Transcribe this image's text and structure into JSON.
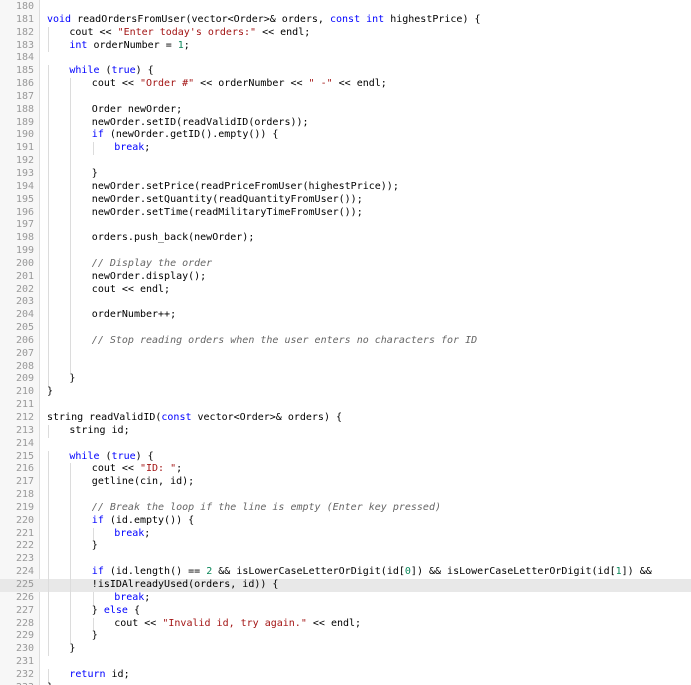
{
  "editor": {
    "active_line": 225,
    "colors": {
      "keyword": "#0000ff",
      "string": "#a31515",
      "comment": "#666666",
      "number": "#098658",
      "gutter_text": "#999999",
      "active_line_bg": "#e8e8e8"
    },
    "lines": [
      {
        "num": "180",
        "indent": 0,
        "tokens": []
      },
      {
        "num": "181",
        "indent": 0,
        "tokens": [
          [
            "kw",
            "void"
          ],
          [
            "t",
            " readOrdersFromUser(vector<Order>& orders, "
          ],
          [
            "kw",
            "const"
          ],
          [
            "t",
            " "
          ],
          [
            "kw",
            "int"
          ],
          [
            "t",
            " highestPrice) {"
          ]
        ]
      },
      {
        "num": "182",
        "indent": 1,
        "tokens": [
          [
            "t",
            "cout << "
          ],
          [
            "str",
            "\"Enter today's orders:\""
          ],
          [
            "t",
            " << endl;"
          ]
        ]
      },
      {
        "num": "183",
        "indent": 1,
        "tokens": [
          [
            "kw",
            "int"
          ],
          [
            "t",
            " orderNumber = "
          ],
          [
            "num",
            "1"
          ],
          [
            "t",
            ";"
          ]
        ]
      },
      {
        "num": "184",
        "indent": 0,
        "tokens": []
      },
      {
        "num": "185",
        "indent": 1,
        "tokens": [
          [
            "kw",
            "while"
          ],
          [
            "t",
            " ("
          ],
          [
            "kw",
            "true"
          ],
          [
            "t",
            ") {"
          ]
        ]
      },
      {
        "num": "186",
        "indent": 2,
        "tokens": [
          [
            "t",
            "cout << "
          ],
          [
            "str",
            "\"Order #\""
          ],
          [
            "t",
            " << orderNumber << "
          ],
          [
            "str",
            "\" -\""
          ],
          [
            "t",
            " << endl;"
          ]
        ]
      },
      {
        "num": "187",
        "indent": 0,
        "guides": 2,
        "tokens": []
      },
      {
        "num": "188",
        "indent": 2,
        "tokens": [
          [
            "t",
            "Order newOrder;"
          ]
        ]
      },
      {
        "num": "189",
        "indent": 2,
        "tokens": [
          [
            "t",
            "newOrder.setID(readValidID(orders));"
          ]
        ]
      },
      {
        "num": "190",
        "indent": 2,
        "tokens": [
          [
            "kw",
            "if"
          ],
          [
            "t",
            " (newOrder.getID().empty()) {"
          ]
        ]
      },
      {
        "num": "191",
        "indent": 3,
        "tokens": [
          [
            "kw",
            "break"
          ],
          [
            "t",
            ";"
          ]
        ]
      },
      {
        "num": "192",
        "indent": 0,
        "guides": 2,
        "tokens": []
      },
      {
        "num": "193",
        "indent": 2,
        "tokens": [
          [
            "t",
            "}"
          ]
        ]
      },
      {
        "num": "194",
        "indent": 2,
        "tokens": [
          [
            "t",
            "newOrder.setPrice(readPriceFromUser(highestPrice));"
          ]
        ]
      },
      {
        "num": "195",
        "indent": 2,
        "tokens": [
          [
            "t",
            "newOrder.setQuantity(readQuantityFromUser());"
          ]
        ]
      },
      {
        "num": "196",
        "indent": 2,
        "tokens": [
          [
            "t",
            "newOrder.setTime(readMilitaryTimeFromUser());"
          ]
        ]
      },
      {
        "num": "197",
        "indent": 0,
        "guides": 2,
        "tokens": []
      },
      {
        "num": "198",
        "indent": 2,
        "tokens": [
          [
            "t",
            "orders.push_back(newOrder);"
          ]
        ]
      },
      {
        "num": "199",
        "indent": 0,
        "guides": 2,
        "tokens": []
      },
      {
        "num": "200",
        "indent": 2,
        "tokens": [
          [
            "com",
            "// Display the order"
          ]
        ]
      },
      {
        "num": "201",
        "indent": 2,
        "tokens": [
          [
            "t",
            "newOrder.display();"
          ]
        ]
      },
      {
        "num": "202",
        "indent": 2,
        "tokens": [
          [
            "t",
            "cout << endl;"
          ]
        ]
      },
      {
        "num": "203",
        "indent": 0,
        "guides": 2,
        "tokens": []
      },
      {
        "num": "204",
        "indent": 2,
        "tokens": [
          [
            "t",
            "orderNumber++;"
          ]
        ]
      },
      {
        "num": "205",
        "indent": 0,
        "guides": 2,
        "tokens": []
      },
      {
        "num": "206",
        "indent": 2,
        "tokens": [
          [
            "com",
            "// Stop reading orders when the user enters no characters for ID"
          ]
        ]
      },
      {
        "num": "207",
        "indent": 0,
        "guides": 2,
        "tokens": []
      },
      {
        "num": "208",
        "indent": 0,
        "guides": 2,
        "tokens": []
      },
      {
        "num": "209",
        "indent": 1,
        "tokens": [
          [
            "t",
            "}"
          ]
        ]
      },
      {
        "num": "210",
        "indent": 0,
        "tokens": [
          [
            "t",
            "}"
          ]
        ]
      },
      {
        "num": "211",
        "indent": 0,
        "tokens": []
      },
      {
        "num": "212",
        "indent": 0,
        "tokens": [
          [
            "t",
            "string readValidID("
          ],
          [
            "kw",
            "const"
          ],
          [
            "t",
            " vector<Order>& orders) {"
          ]
        ]
      },
      {
        "num": "213",
        "indent": 1,
        "tokens": [
          [
            "t",
            "string id;"
          ]
        ]
      },
      {
        "num": "214",
        "indent": 0,
        "tokens": []
      },
      {
        "num": "215",
        "indent": 1,
        "tokens": [
          [
            "kw",
            "while"
          ],
          [
            "t",
            " ("
          ],
          [
            "kw",
            "true"
          ],
          [
            "t",
            ") {"
          ]
        ]
      },
      {
        "num": "216",
        "indent": 2,
        "tokens": [
          [
            "t",
            "cout << "
          ],
          [
            "str",
            "\"ID: \""
          ],
          [
            "t",
            ";"
          ]
        ]
      },
      {
        "num": "217",
        "indent": 2,
        "tokens": [
          [
            "t",
            "getline(cin, id);"
          ]
        ]
      },
      {
        "num": "218",
        "indent": 0,
        "guides": 2,
        "tokens": []
      },
      {
        "num": "219",
        "indent": 2,
        "tokens": [
          [
            "com",
            "// Break the loop if the line is empty (Enter key pressed)"
          ]
        ]
      },
      {
        "num": "220",
        "indent": 2,
        "tokens": [
          [
            "kw",
            "if"
          ],
          [
            "t",
            " (id.empty()) {"
          ]
        ]
      },
      {
        "num": "221",
        "indent": 3,
        "tokens": [
          [
            "kw",
            "break"
          ],
          [
            "t",
            ";"
          ]
        ]
      },
      {
        "num": "222",
        "indent": 2,
        "tokens": [
          [
            "t",
            "}"
          ]
        ]
      },
      {
        "num": "223",
        "indent": 0,
        "guides": 2,
        "tokens": []
      },
      {
        "num": "224",
        "indent": 2,
        "tokens": [
          [
            "kw",
            "if"
          ],
          [
            "t",
            " (id.length() == "
          ],
          [
            "num",
            "2"
          ],
          [
            "t",
            " && isLowerCaseLetterOrDigit(id["
          ],
          [
            "num",
            "0"
          ],
          [
            "t",
            "]) && isLowerCaseLetterOrDigit(id["
          ],
          [
            "num",
            "1"
          ],
          [
            "t",
            "]) &&"
          ]
        ]
      },
      {
        "num": "225",
        "indent": 2,
        "tokens": [
          [
            "t",
            "!isIDAlreadyUsed(orders, id)) {"
          ]
        ]
      },
      {
        "num": "226",
        "indent": 3,
        "tokens": [
          [
            "kw",
            "break"
          ],
          [
            "t",
            ";"
          ]
        ]
      },
      {
        "num": "227",
        "indent": 2,
        "tokens": [
          [
            "t",
            "} "
          ],
          [
            "kw",
            "else"
          ],
          [
            "t",
            " {"
          ]
        ]
      },
      {
        "num": "228",
        "indent": 3,
        "tokens": [
          [
            "t",
            "cout << "
          ],
          [
            "str",
            "\"Invalid id, try again.\""
          ],
          [
            "t",
            " << endl;"
          ]
        ]
      },
      {
        "num": "229",
        "indent": 2,
        "tokens": [
          [
            "t",
            "}"
          ]
        ]
      },
      {
        "num": "230",
        "indent": 1,
        "tokens": [
          [
            "t",
            "}"
          ]
        ]
      },
      {
        "num": "231",
        "indent": 0,
        "tokens": []
      },
      {
        "num": "232",
        "indent": 1,
        "tokens": [
          [
            "kw",
            "return"
          ],
          [
            "t",
            " id;"
          ]
        ]
      },
      {
        "num": "233",
        "indent": 0,
        "tokens": [
          [
            "t",
            "}"
          ]
        ]
      }
    ]
  }
}
